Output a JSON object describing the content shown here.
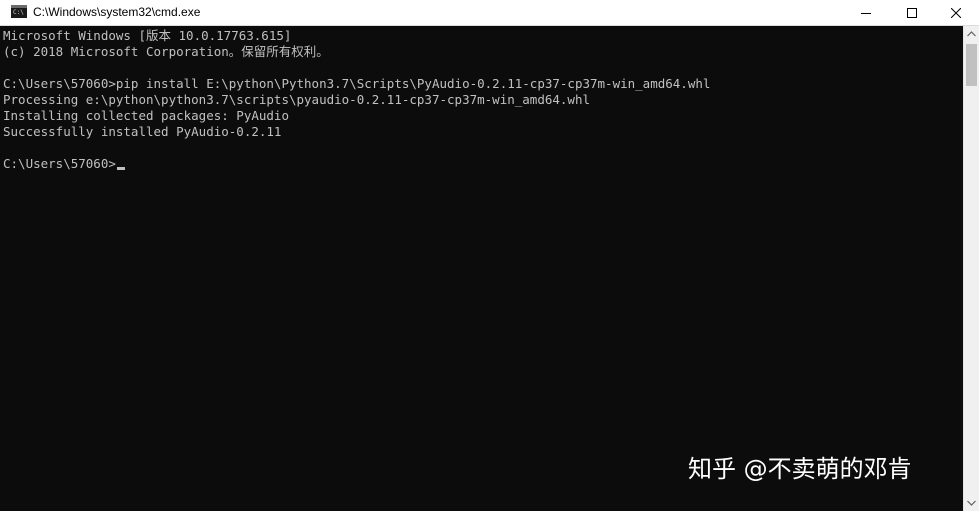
{
  "window": {
    "title": "C:\\Windows\\system32\\cmd.exe",
    "icon": "cmd-icon",
    "icon_text": "C:\\"
  },
  "controls": {
    "minimize": "minimize-icon",
    "maximize": "maximize-icon",
    "close": "close-icon"
  },
  "console": {
    "lines": [
      "Microsoft Windows [版本 10.0.17763.615]",
      "(c) 2018 Microsoft Corporation。保留所有权利。",
      "",
      "C:\\Users\\57060>pip install E:\\python\\Python3.7\\Scripts\\PyAudio-0.2.11-cp37-cp37m-win_amd64.whl",
      "Processing e:\\python\\python3.7\\scripts\\pyaudio-0.2.11-cp37-cp37m-win_amd64.whl",
      "Installing collected packages: PyAudio",
      "Successfully installed PyAudio-0.2.11",
      "",
      "C:\\Users\\57060>"
    ],
    "text_color": "#c0c0c0",
    "background": "#0c0c0c"
  },
  "watermark": {
    "text": "知乎 @不卖萌的邓肯"
  }
}
